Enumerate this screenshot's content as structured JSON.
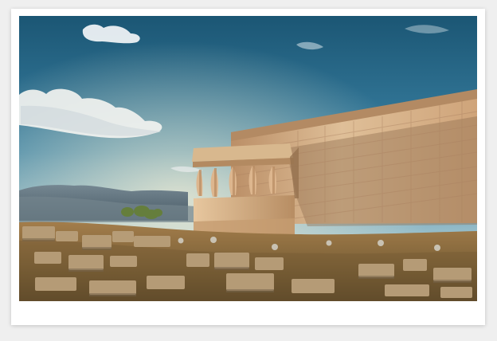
{
  "photo": {
    "subject": "",
    "colors": {
      "sky_top": "#1b5674",
      "sky_mid": "#3b82a4",
      "sky_horizon": "#d8d4c6",
      "stone_light": "#dcb98e",
      "stone_mid": "#c59a70",
      "stone_shadow": "#8e6a4c",
      "ground": "#8f7143",
      "hills": "#5e6f79"
    }
  }
}
